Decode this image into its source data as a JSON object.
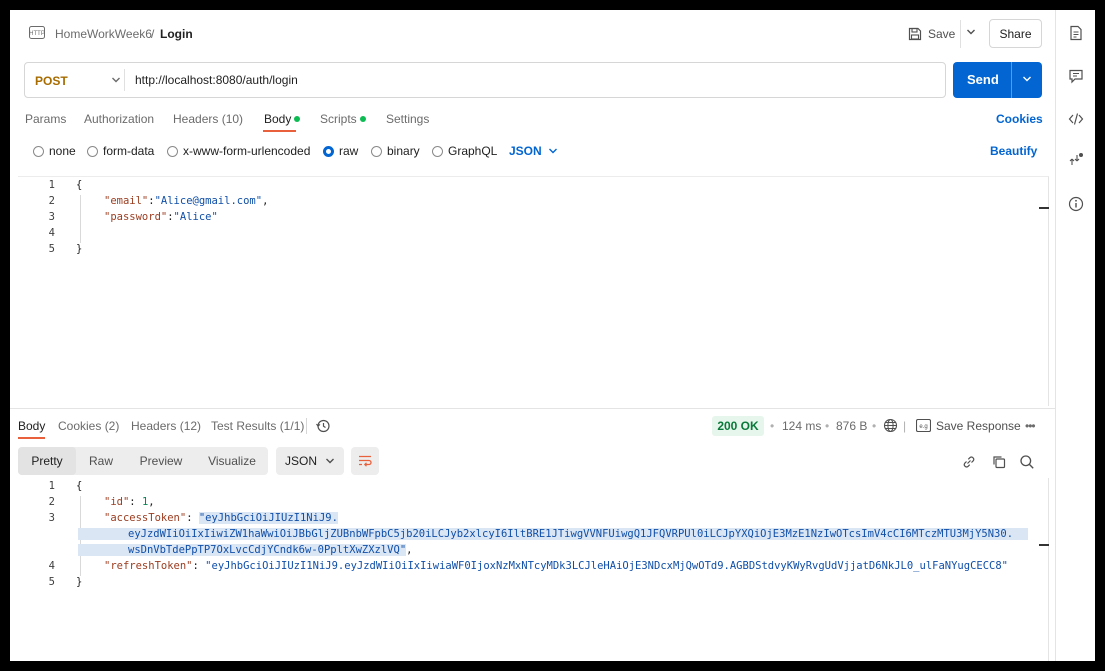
{
  "breadcrumb": {
    "collection": "HomeWorkWeek6",
    "separator": "/",
    "request": "Login"
  },
  "header": {
    "save_label": "Save",
    "share_label": "Share"
  },
  "request": {
    "method": "POST",
    "url": "http://localhost:8080/auth/login",
    "send_label": "Send"
  },
  "tabs": {
    "params": "Params",
    "authorization": "Authorization",
    "headers": "Headers (10)",
    "body": "Body",
    "scripts": "Scripts",
    "settings": "Settings",
    "cookies": "Cookies"
  },
  "body_types": {
    "none": "none",
    "form_data": "form-data",
    "urlencoded": "x-www-form-urlencoded",
    "raw": "raw",
    "binary": "binary",
    "graphql": "GraphQL",
    "format": "JSON",
    "beautify": "Beautify",
    "selected": "raw"
  },
  "request_body": {
    "line_numbers": [
      "1",
      "2",
      "3",
      "4",
      "5"
    ],
    "open": "{",
    "email_key": "\"email\"",
    "email_val": "\"Alice@gmail.com\"",
    "password_key": "\"password\"",
    "password_val": "\"Alice\"",
    "close": "}"
  },
  "response": {
    "tabs": {
      "body": "Body",
      "cookies": "Cookies (2)",
      "headers": "Headers (12)",
      "tests": "Test Results (1/1)"
    },
    "status": "200 OK",
    "time": "124 ms",
    "size": "876 B",
    "save_response": "Save Response",
    "views": {
      "pretty": "Pretty",
      "raw": "Raw",
      "preview": "Preview",
      "visualize": "Visualize"
    },
    "format": "JSON",
    "line_numbers": [
      "1",
      "2",
      "3",
      "4",
      "5"
    ],
    "open": "{",
    "id_key": "\"id\"",
    "id_val": "1",
    "access_key": "\"accessToken\"",
    "access_val_1": "\"eyJhbGciOiJIUzI1NiJ9.",
    "access_val_2": "eyJzdWIiOiIxIiwiZW1haWwiOiJBbGljZUBnbWFpbC5jb20iLCJyb2xlcyI6IltBRE1JTiwgVVNFUiwgQ1JFQVRPUl0iLCJpYXQiOjE3MzE1NzIwOTcsImV4cCI6MTczMTU3MjY5N30.",
    "access_val_3": "wsDnVbTdePpTP7OxLvcCdjYCndk6w-0PpltXwZXzlVQ\"",
    "refresh_key": "\"refreshToken\"",
    "refresh_val": "\"eyJhbGciOiJIUzI1NiJ9.eyJzdWIiOiIxIiwiaWF0IjoxNzMxNTcyMDk3LCJleHAiOjE3NDcxMjQwOTd9.AGBDStdvyKWyRvgUdVjjatD6NkJL0_ulFaNYugCECC8\"",
    "close": "}"
  },
  "colors": {
    "accent": "#0265d2",
    "tab_indicator": "#e8603c",
    "status_ok": "#097a3a",
    "method": "#a76b00"
  }
}
